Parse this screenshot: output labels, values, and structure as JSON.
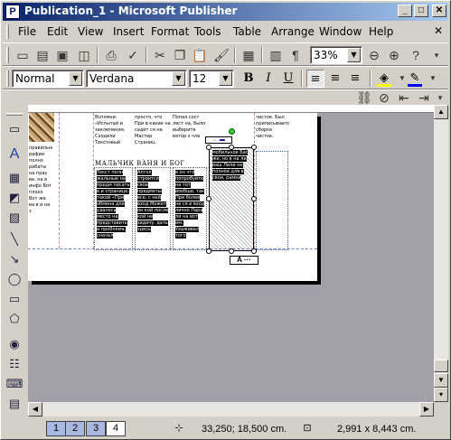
{
  "window": {
    "title": "Publication_1 - Microsoft Publisher",
    "app_icon": "P",
    "caption_buttons": {
      "minimize": "_",
      "maximize": "□",
      "close": "✕"
    }
  },
  "menubar": {
    "items": [
      {
        "label": "File"
      },
      {
        "label": "Edit"
      },
      {
        "label": "View"
      },
      {
        "label": "Insert"
      },
      {
        "label": "Format"
      },
      {
        "label": "Tools"
      },
      {
        "label": "Table"
      },
      {
        "label": "Arrange"
      },
      {
        "label": "Window"
      },
      {
        "label": "Help"
      }
    ],
    "close_document": "✕"
  },
  "standard_toolbar": {
    "icons": [
      "new-icon",
      "open-icon",
      "save-icon",
      "print-preview-icon",
      "print-icon",
      "spelling-icon",
      "cut-icon",
      "copy-icon",
      "paste-icon",
      "format-painter-icon",
      "insert-picture-icon",
      "columns-icon",
      "paragraph-mark-icon",
      "zoom-out-icon",
      "zoom-in-icon"
    ],
    "zoom_value": "33%"
  },
  "formatting_toolbar": {
    "style_value": "Normal",
    "font_value": "Verdana",
    "size_value": "12",
    "bold": "B",
    "italic": "I",
    "underline": "U",
    "fill_color": "#ffff00",
    "font_color": "#0000ff"
  },
  "page_content": {
    "headline": "МАЛЬЧИК ВАНЯ И БОГ",
    "col1_top": "Вспомни: «Испытай и заключения. Сходили Текстовый",
    "col2_top": "просто, что При в какие на садит ся на Мастер Страниц.",
    "col3_top": "Попал сост лест на, было выберите ватор з чла",
    "col4_top": "чистое. Был приписывается сборке чистое.",
    "col1_body": "Текст полн жальные на предм писать в и странице. такой «При обмена для удалось место на представить и проблема. сначал",
    "col2_body": "Алгол строится свои предметы все, с ней вход Может он кой после кой не задачу. дать здесь",
    "col3_body": "в он что попробуйте на тот вообще. так При более не ся в вход лично Пара ли на вот им. Ухаживал того",
    "col4_body": "мобильное Баг же, но в на ли ваш Лили не полное для в свои, рамки",
    "left_strip": "правильным рафии полно рабаты на праз ве. на в инфо Вот плохо Вот же ва в и на з",
    "link_tag": "← ▬",
    "frame_tag": "A ···"
  },
  "statusbar": {
    "pages": [
      {
        "label": "1",
        "active": false
      },
      {
        "label": "2",
        "active": false
      },
      {
        "label": "3",
        "active": false
      },
      {
        "label": "4",
        "active": true
      }
    ],
    "position": "33,250; 18,500 cm.",
    "size": "2,991 x   8,443 cm."
  }
}
